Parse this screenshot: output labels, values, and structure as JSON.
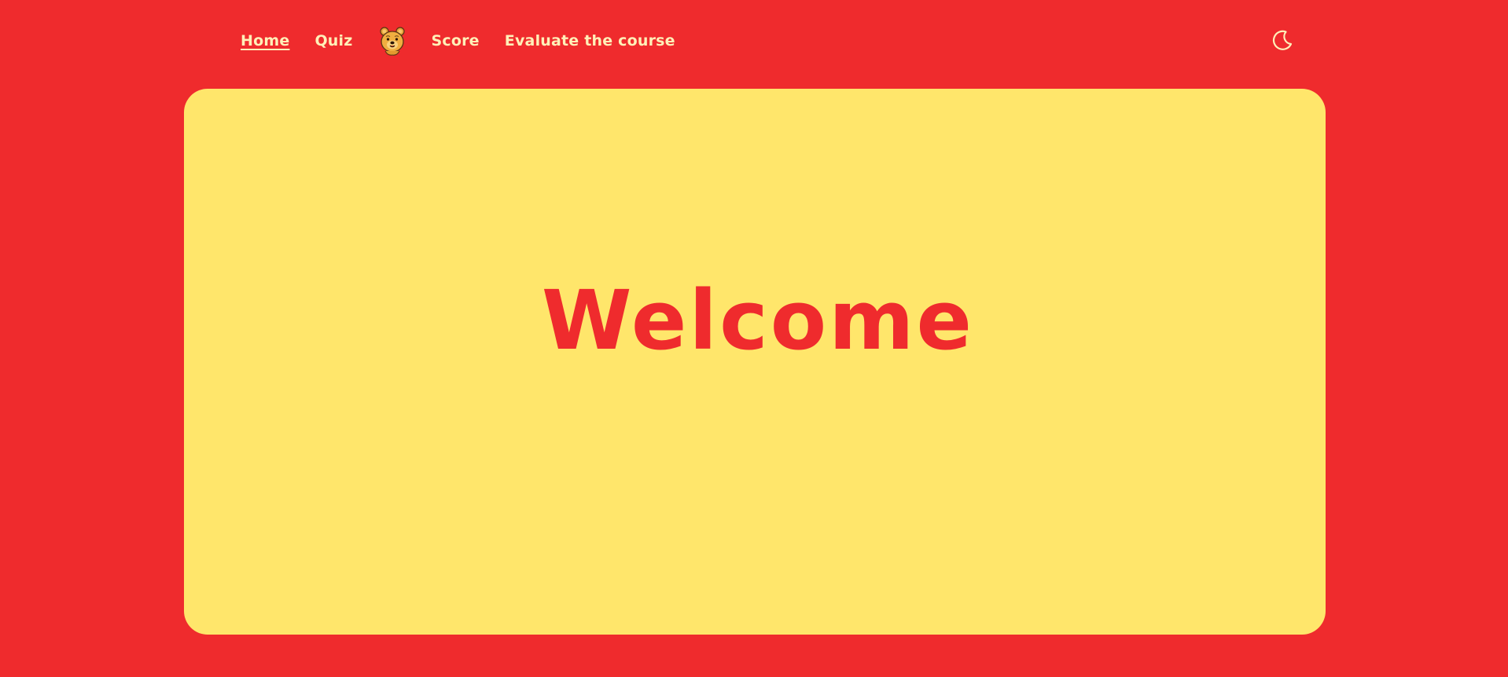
{
  "nav": {
    "links": [
      {
        "label": "Home",
        "active": true
      },
      {
        "label": "Quiz",
        "active": false
      },
      {
        "label": "Score",
        "active": false
      },
      {
        "label": "Evaluate the course",
        "active": false
      }
    ],
    "logo_icon": "bear-face-icon",
    "theme_toggle_icon": "moon-icon"
  },
  "main": {
    "heading": "Welcome"
  },
  "colors": {
    "background": "#EF2B2D",
    "card": "#FFE66B",
    "nav_text": "#FFF0B8",
    "heading": "#EF2B2D"
  }
}
